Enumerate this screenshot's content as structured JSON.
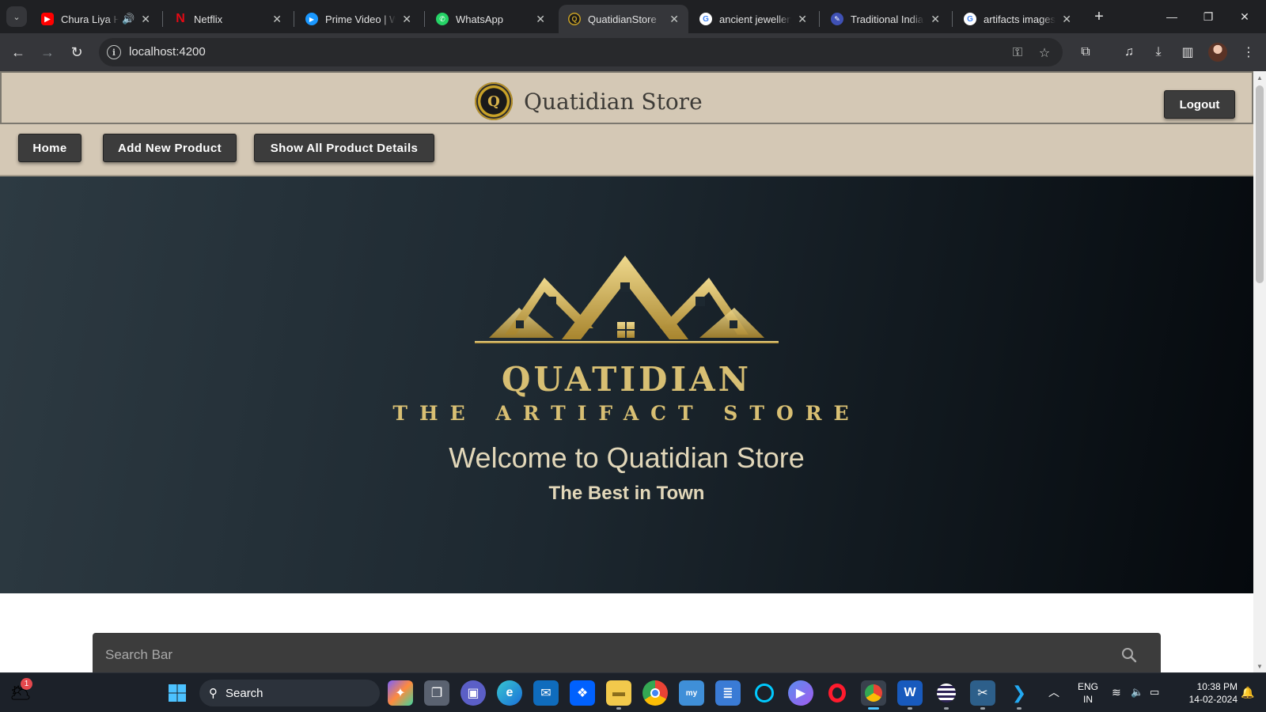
{
  "browser": {
    "tabs": [
      {
        "title": "Chura Liya Hai",
        "favicon": "youtube-icon",
        "color": "#ff0000"
      },
      {
        "title": "Netflix",
        "favicon": "netflix-icon",
        "color": "#e50914"
      },
      {
        "title": "Prime Video | Watch",
        "favicon": "prime-video-icon",
        "color": "#1a98ff"
      },
      {
        "title": "WhatsApp",
        "favicon": "whatsapp-icon",
        "color": "#25d366"
      },
      {
        "title": "QuatidianStore",
        "favicon": "quatidian-icon",
        "color": "#c9a227"
      },
      {
        "title": "ancient jewellery",
        "favicon": "google-icon",
        "color": "#4285f4"
      },
      {
        "title": "Traditional Indian",
        "favicon": "site-icon",
        "color": "#3f51b5"
      },
      {
        "title": "artifacts images",
        "favicon": "google-icon",
        "color": "#4285f4"
      }
    ],
    "url": "localhost:4200"
  },
  "site": {
    "brand_name": "Quatidian Store",
    "logo_letter": "Q",
    "logout_label": "Logout",
    "nav": {
      "home": "Home",
      "add_product": "Add New Product",
      "show_all": "Show All Product Details"
    },
    "hero": {
      "brand_line1": "QUATIDIAN",
      "brand_line2": "THE ARTIFACT STORE",
      "welcome": "Welcome to Quatidian Store",
      "tagline": "The Best in Town"
    },
    "search_placeholder": "Search Bar",
    "colors": {
      "header_bg": "#d4c8b5",
      "button_bg": "#3c3c3c",
      "gold": "#d8bf73"
    }
  },
  "taskbar": {
    "search_label": "Search",
    "weather_badge": "1",
    "language": "ENG",
    "region": "IN",
    "time": "10:38 PM",
    "date": "14-02-2024"
  }
}
